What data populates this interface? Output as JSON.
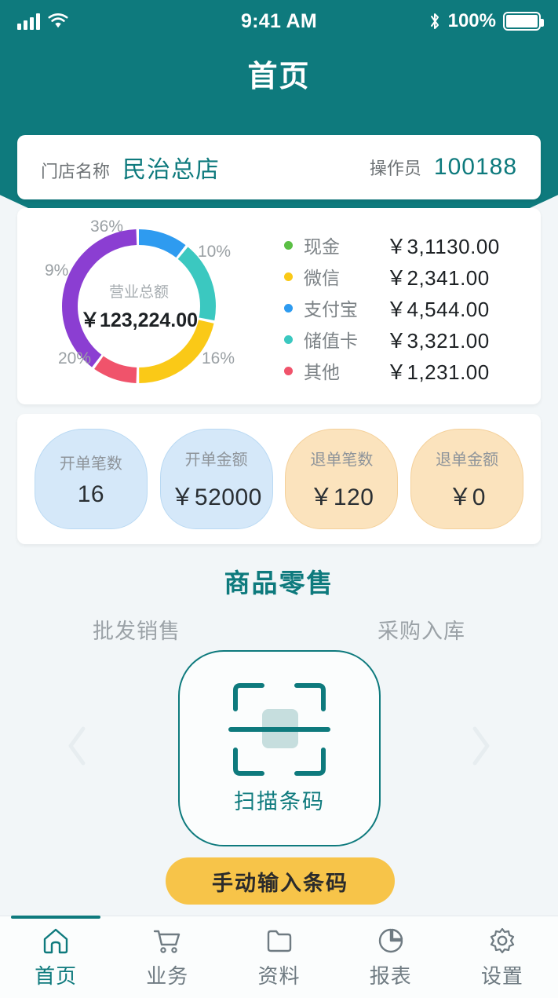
{
  "status_bar": {
    "time": "9:41 AM",
    "battery_percent": "100%",
    "signal_icon": "cellular-signal-icon",
    "wifi_icon": "wifi-icon",
    "bluetooth_icon": "bluetooth-icon",
    "battery_icon": "battery-full-icon"
  },
  "header": {
    "title": "首页",
    "background_color": "#0E7A7D"
  },
  "store_card": {
    "store_label": "门店名称",
    "store_value": "民治总店",
    "operator_label": "操作员",
    "operator_value": "100188"
  },
  "chart_data": {
    "type": "pie",
    "title": "营业总额",
    "center_label": "营业总额",
    "center_value": "￥123,224.00",
    "categories": [
      "支付宝",
      "储值卡",
      "微信",
      "其他",
      "现金"
    ],
    "values": [
      10,
      16,
      20,
      9,
      36
    ],
    "pct_labels": [
      "10%",
      "16%",
      "20%",
      "9%",
      "36%"
    ],
    "colors": [
      "#2E9BF0",
      "#3BC8C0",
      "#FAC917",
      "#F0536B",
      "#8B3ED2"
    ],
    "legend_position": "right",
    "grid": false,
    "legend": [
      {
        "name": "现金",
        "value": "￥3,1130.00",
        "color": "#5BBF45"
      },
      {
        "name": "微信",
        "value": "￥2,341.00",
        "color": "#FAC917"
      },
      {
        "name": "支付宝",
        "value": "￥4,544.00",
        "color": "#2E9BF0"
      },
      {
        "name": "储值卡",
        "value": "￥3,321.00",
        "color": "#3BC8C0"
      },
      {
        "name": "其他",
        "value": "￥1,231.00",
        "color": "#F0536B"
      }
    ]
  },
  "stats": [
    {
      "label": "开单笔数",
      "value": "16",
      "tone": "blue"
    },
    {
      "label": "开单金额",
      "value": "￥52000",
      "tone": "blue"
    },
    {
      "label": "退单笔数",
      "value": "￥120",
      "tone": "orange"
    },
    {
      "label": "退单金额",
      "value": "￥0",
      "tone": "orange"
    }
  ],
  "carousel": {
    "active_title": "商品零售",
    "left_label": "批发销售",
    "right_label": "采购入库",
    "prev_icon": "chevron-left-icon",
    "next_icon": "chevron-right-icon",
    "scan": {
      "icon": "barcode-scan-icon",
      "label": "扫描条码"
    }
  },
  "manual_button": {
    "label": "手动输入条码",
    "color": "#F7C449"
  },
  "tabbar": {
    "items": [
      {
        "label": "首页",
        "icon": "home-icon",
        "active": true
      },
      {
        "label": "业务",
        "icon": "cart-icon",
        "active": false
      },
      {
        "label": "资料",
        "icon": "folder-icon",
        "active": false
      },
      {
        "label": "报表",
        "icon": "chart-pie-icon",
        "active": false
      },
      {
        "label": "设置",
        "icon": "gear-icon",
        "active": false
      }
    ]
  }
}
